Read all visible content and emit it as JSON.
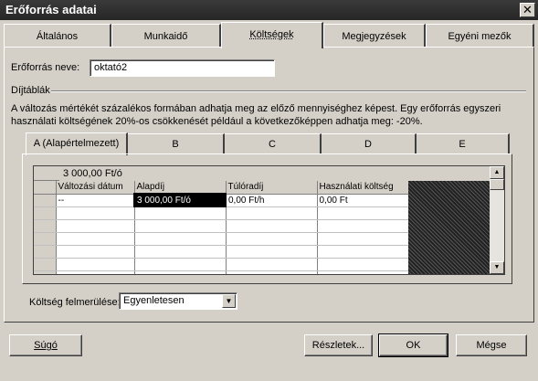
{
  "window": {
    "title": "Erőforrás adatai",
    "close_label": "✕"
  },
  "tabs": [
    {
      "label": "Általános"
    },
    {
      "label": "Munkaidő"
    },
    {
      "label": "Költségek"
    },
    {
      "label": "Megjegyzések"
    },
    {
      "label": "Egyéni mezők"
    }
  ],
  "resource_name": {
    "label": "Erőforrás neve:",
    "value": "oktató2"
  },
  "rates": {
    "group_label": "Díjtáblák",
    "description": "A változás mértékét százalékos formában adhatja meg az előző mennyiséghez képest. Egy erőforrás egyszeri használati költségének 20%-os csökkenését például a következőképpen adhatja meg: -20%.",
    "subtabs": [
      {
        "label": "A (Alapértelmezett)"
      },
      {
        "label": "B"
      },
      {
        "label": "C"
      },
      {
        "label": "D"
      },
      {
        "label": "E"
      }
    ],
    "edit_value": "3 000,00 Ft/ó",
    "columns": [
      "Változási dátum",
      "Alapdíj",
      "Túlóradíj",
      "Használati költség"
    ],
    "rows": [
      [
        "--",
        "3 000,00 Ft/ó",
        "0,00 Ft/h",
        "0,00 Ft"
      ]
    ]
  },
  "cost_accrual": {
    "label": "Költség felmerülése:",
    "value": "Egyenletesen"
  },
  "buttons": {
    "help": "Súgó",
    "details": "Részletek...",
    "ok": "OK",
    "cancel": "Mégse"
  }
}
